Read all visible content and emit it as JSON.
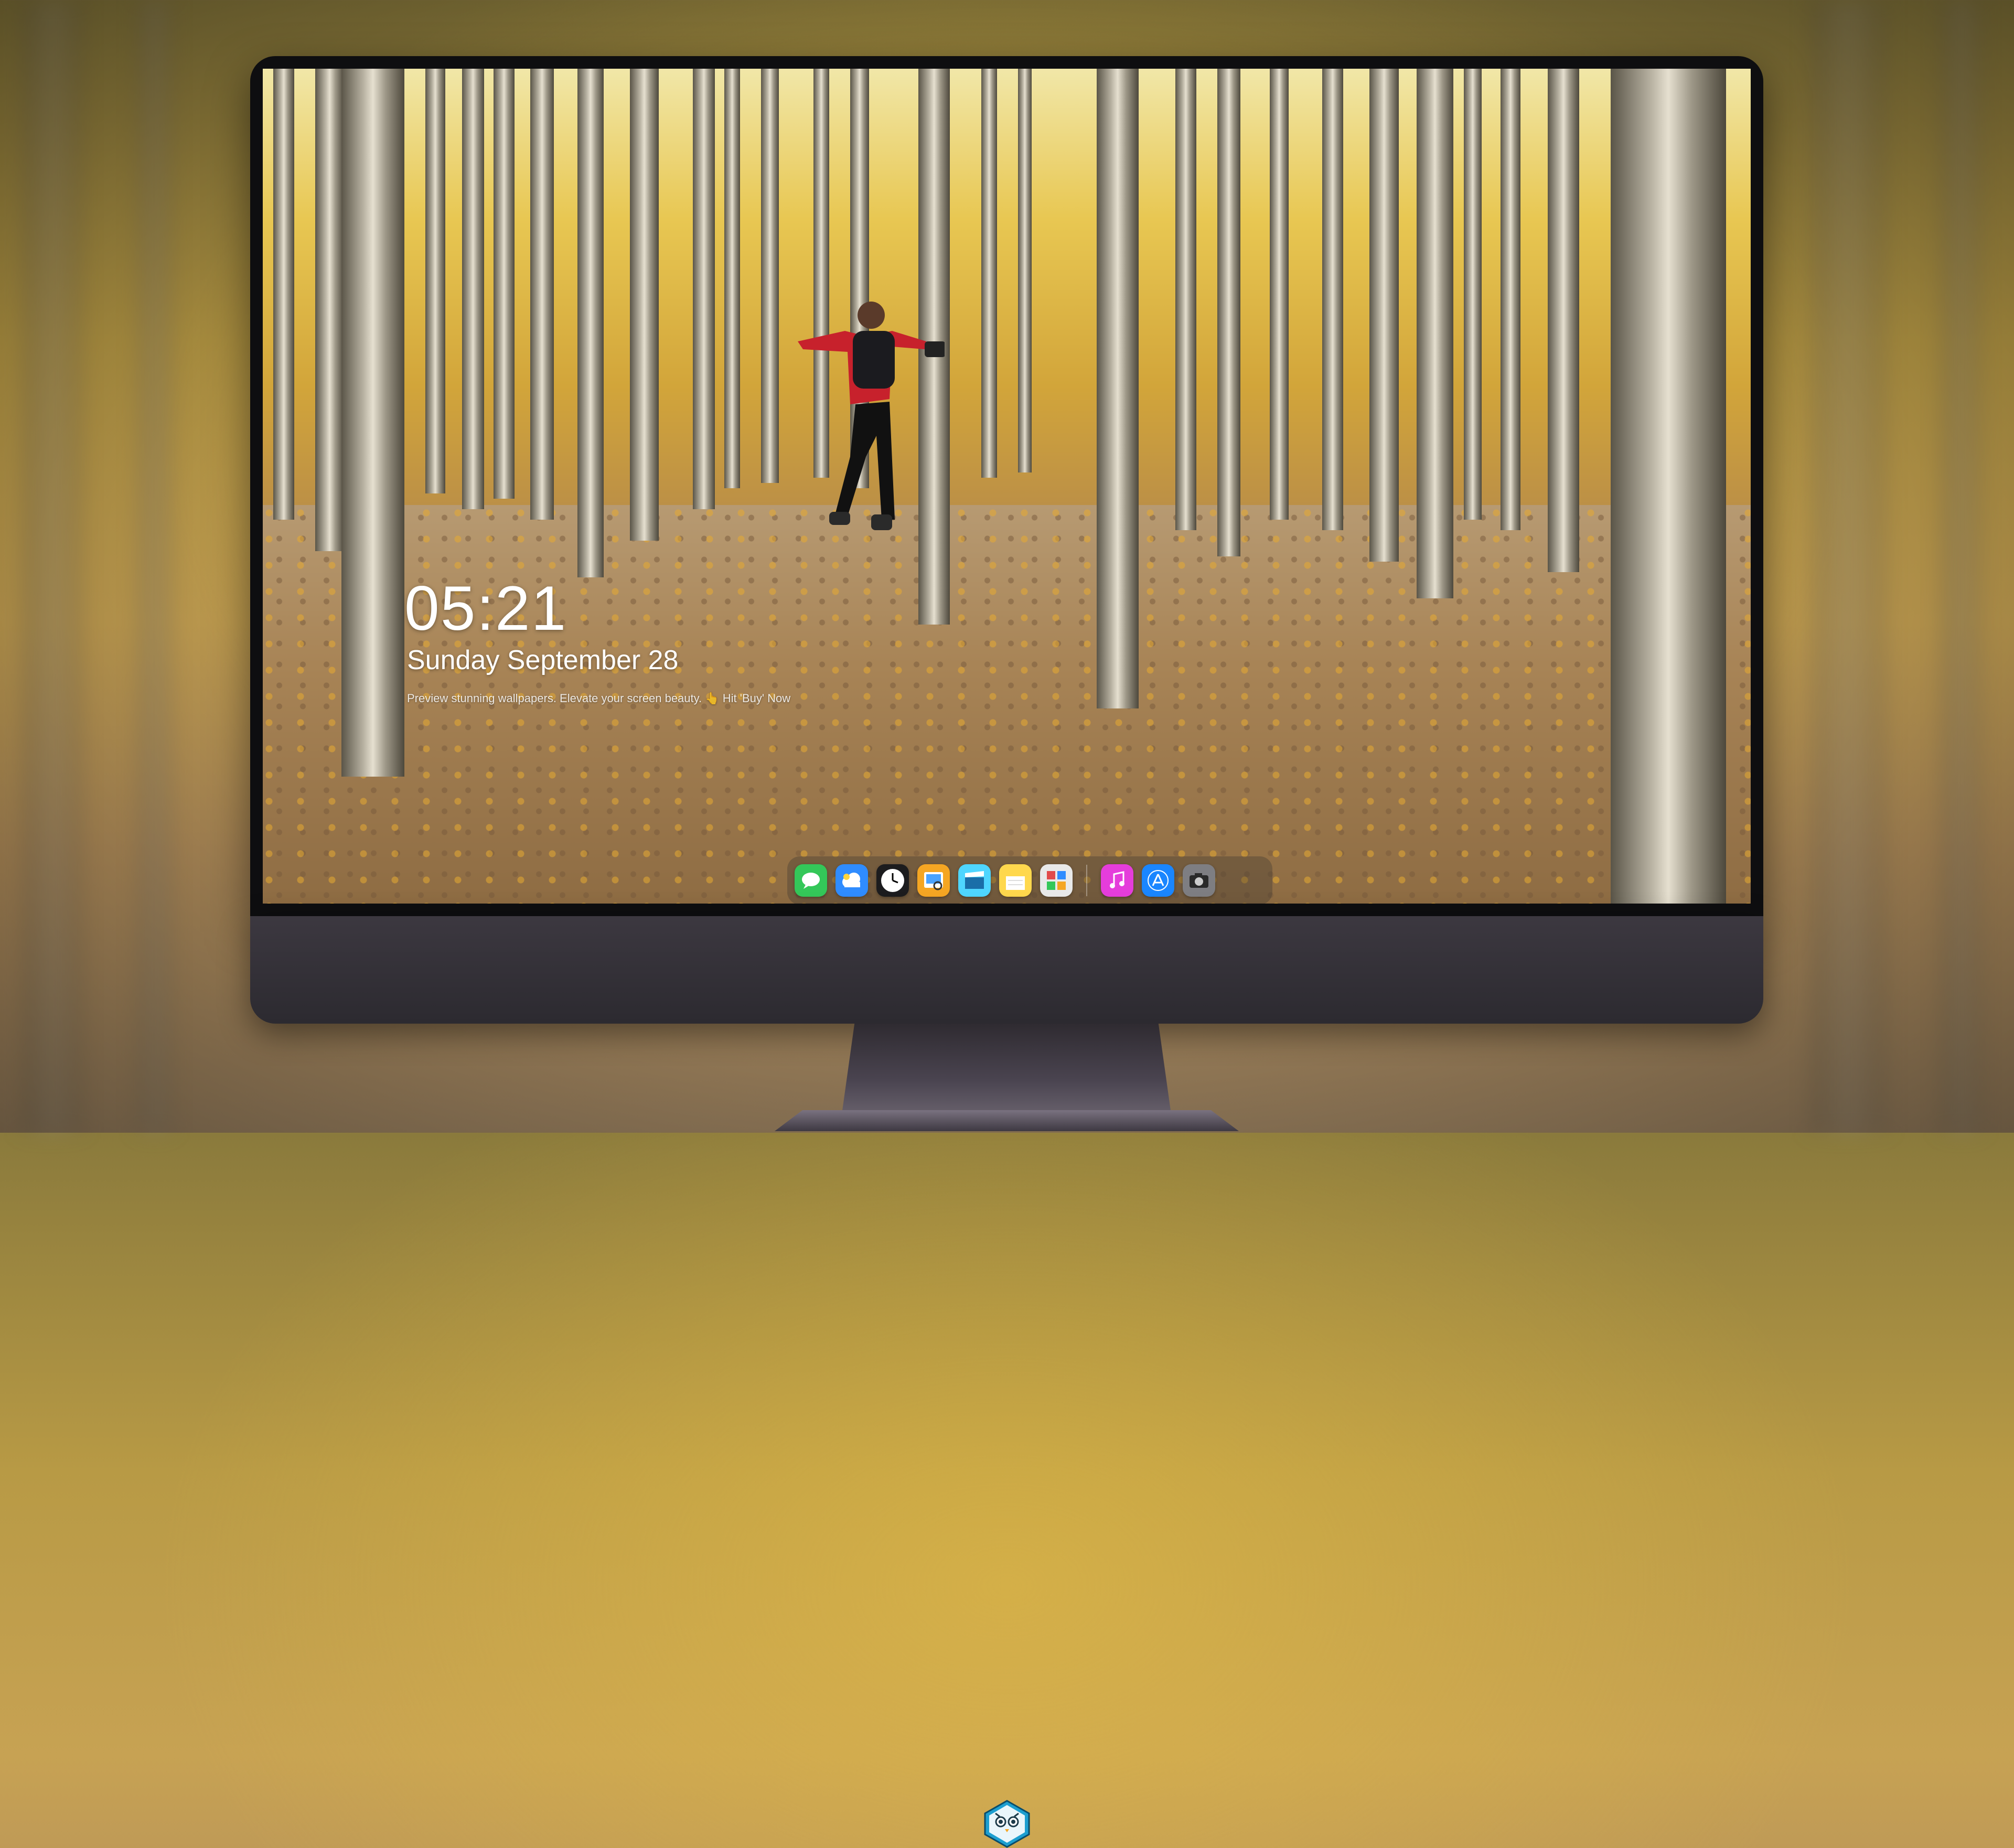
{
  "lockscreen": {
    "time": "05:21",
    "date": "Sunday September 28",
    "tagline": "Preview stunning wallpapers. Elevate your screen beauty. 👆 Hit 'Buy' Now"
  },
  "dock": {
    "apps": [
      {
        "name": "Messages",
        "icon": "message-bubble-icon",
        "color": "#34c759"
      },
      {
        "name": "Weather",
        "icon": "cloud-icon",
        "color": "#2f8cff"
      },
      {
        "name": "Clock",
        "icon": "clock-icon",
        "color": "#1c1c1e"
      },
      {
        "name": "Preview",
        "icon": "preview-icon",
        "color": "#f5a623"
      },
      {
        "name": "Clips",
        "icon": "clapperboard-icon",
        "color": "#4fd6ff"
      },
      {
        "name": "Notes",
        "icon": "notes-icon",
        "color": "#ffd84d"
      },
      {
        "name": "Photo Booth",
        "icon": "photos-grid-icon",
        "color": "#e14b4b"
      },
      {
        "name": "Music",
        "icon": "music-note-icon",
        "color": "#e53ddb"
      },
      {
        "name": "App Store",
        "icon": "app-store-icon",
        "color": "#1a86ff"
      },
      {
        "name": "Camera",
        "icon": "camera-icon",
        "color": "#7e7e82"
      }
    ]
  },
  "brand": {
    "logo": "owl-mascot-logo-icon"
  }
}
